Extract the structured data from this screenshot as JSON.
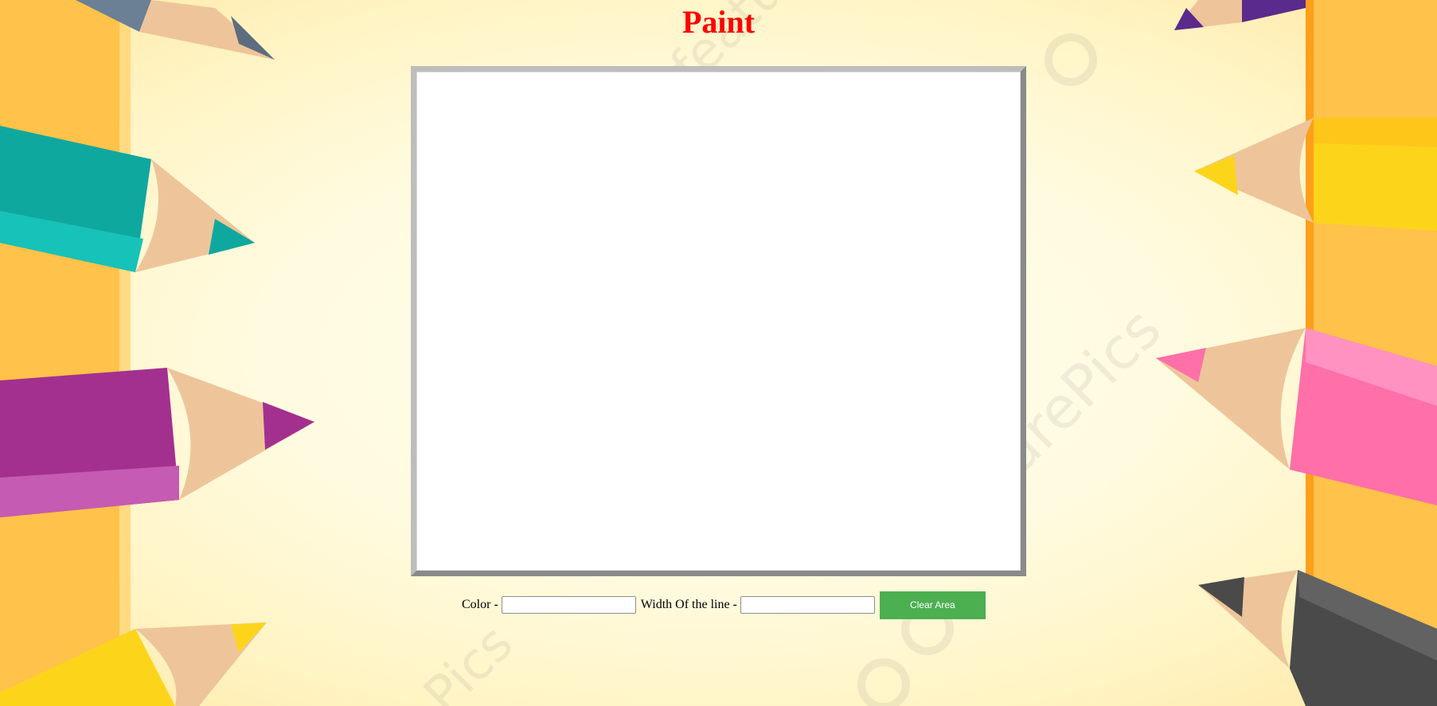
{
  "page": {
    "title": "Paint"
  },
  "controls": {
    "color_label": "Color -",
    "color_value": "",
    "width_label": "Width Of the line -",
    "width_value": "",
    "clear_label": "Clear Area"
  },
  "theme": {
    "title_color": "#ff0000",
    "button_color": "#4caf50",
    "background_color": "#fff9d6"
  },
  "background": {
    "watermark_text": "featurePics",
    "pencil_colors": [
      "#6b7f95",
      "#0fa89f",
      "#a3308f",
      "#fcd51b",
      "#5a2a8c",
      "#fcd51b",
      "#ff6fa8",
      "#4a4a4a"
    ]
  }
}
